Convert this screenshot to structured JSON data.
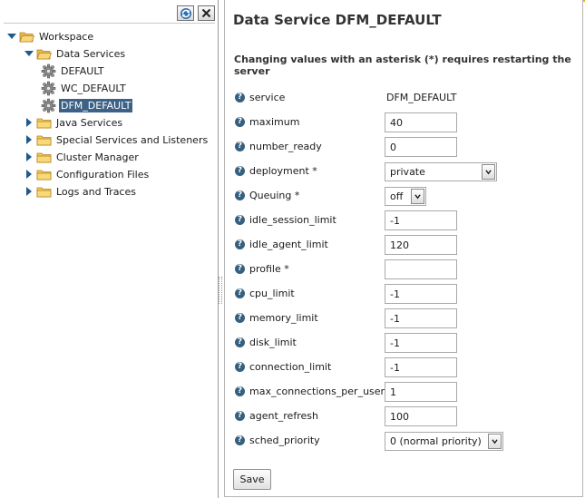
{
  "tree": {
    "items": [
      {
        "label": "Workspace",
        "icon": "folder-open-icon",
        "expanded": true
      },
      {
        "label": "Data Services",
        "icon": "folder-open-icon",
        "expanded": true
      },
      {
        "label": "DEFAULT",
        "icon": "gear-icon"
      },
      {
        "label": "WC_DEFAULT",
        "icon": "gear-icon"
      },
      {
        "label": "DFM_DEFAULT",
        "icon": "gear-icon",
        "selected": true
      },
      {
        "label": "Java Services",
        "icon": "folder-icon",
        "expanded": false
      },
      {
        "label": "Special Services and Listeners",
        "icon": "folder-icon",
        "expanded": false
      },
      {
        "label": "Cluster Manager",
        "icon": "folder-icon",
        "expanded": false
      },
      {
        "label": "Configuration Files",
        "icon": "folder-icon",
        "expanded": false
      },
      {
        "label": "Logs and Traces",
        "icon": "folder-icon",
        "expanded": false
      }
    ]
  },
  "detail": {
    "title": "Data Service DFM_DEFAULT",
    "restart_note": "Changing values with an asterisk (*) requires restarting the server",
    "fields": [
      {
        "label": "service",
        "type": "static",
        "value": "DFM_DEFAULT"
      },
      {
        "label": "maximum",
        "type": "input",
        "value": "40"
      },
      {
        "label": "number_ready",
        "type": "input",
        "value": "0"
      },
      {
        "label": "deployment *",
        "type": "select",
        "value": "private"
      },
      {
        "label": "Queuing *",
        "type": "select",
        "value": "off"
      },
      {
        "label": "idle_session_limit",
        "type": "input",
        "value": "-1"
      },
      {
        "label": "idle_agent_limit",
        "type": "input",
        "value": "120"
      },
      {
        "label": "profile *",
        "type": "input",
        "value": ""
      },
      {
        "label": "cpu_limit",
        "type": "input",
        "value": "-1"
      },
      {
        "label": "memory_limit",
        "type": "input",
        "value": "-1"
      },
      {
        "label": "disk_limit",
        "type": "input",
        "value": "-1"
      },
      {
        "label": "connection_limit",
        "type": "input",
        "value": "-1"
      },
      {
        "label": "max_connections_per_user *",
        "type": "input",
        "value": "1"
      },
      {
        "label": "agent_refresh",
        "type": "input",
        "value": "100"
      },
      {
        "label": "sched_priority",
        "type": "select",
        "value": "0 (normal priority)"
      }
    ],
    "save_label": "Save",
    "help_glyph": "?"
  },
  "colors": {
    "selection": "#3d6287",
    "accent": "#f0b400",
    "help_icon": "#35607f",
    "expander": "#1f5a8e"
  }
}
